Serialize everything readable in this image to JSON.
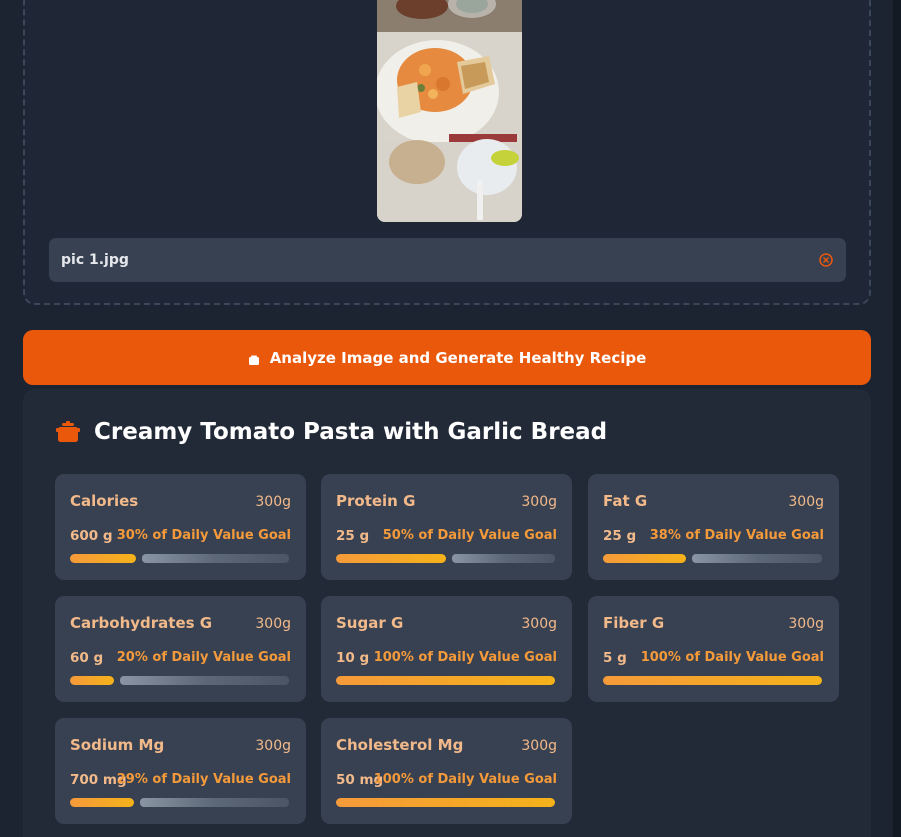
{
  "upload": {
    "file_name": "pic 1.jpg",
    "preview_description": "food-photo-pasta-garlic-bread"
  },
  "actions": {
    "analyze_label": "Analyze Image and Generate Healthy Recipe",
    "analyze_icon": "pot-icon"
  },
  "recipe": {
    "title": "Creamy Tomato Pasta with Garlic Bread",
    "icon": "pot-icon"
  },
  "colors": {
    "accent": "#ea580c",
    "bar": "#f59a3a",
    "label": "#f2b98a"
  },
  "nutrients": [
    {
      "name": "Calories",
      "weight": "300g",
      "amount": "600 g",
      "dv": "30% of Daily Value Goal",
      "pct": 30
    },
    {
      "name": "Protein G",
      "weight": "300g",
      "amount": "25 g",
      "dv": "50% of Daily Value Goal",
      "pct": 50
    },
    {
      "name": "Fat G",
      "weight": "300g",
      "amount": "25 g",
      "dv": "38% of Daily Value Goal",
      "pct": 38
    },
    {
      "name": "Carbohydrates G",
      "weight": "300g",
      "amount": "60 g",
      "dv": "20% of Daily Value Goal",
      "pct": 20
    },
    {
      "name": "Sugar G",
      "weight": "300g",
      "amount": "10 g",
      "dv": "100% of Daily Value Goal",
      "pct": 100
    },
    {
      "name": "Fiber G",
      "weight": "300g",
      "amount": "5 g",
      "dv": "100% of Daily Value Goal",
      "pct": 100
    },
    {
      "name": "Sodium Mg",
      "weight": "300g",
      "amount": "700 mg",
      "dv": "29% of Daily Value Goal",
      "pct": 29
    },
    {
      "name": "Cholesterol Mg",
      "weight": "300g",
      "amount": "50 mg",
      "dv": "100% of Daily Value Goal",
      "pct": 100
    }
  ]
}
